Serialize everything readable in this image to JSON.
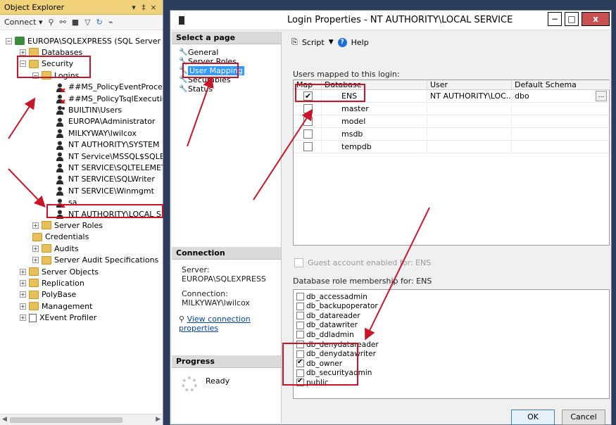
{
  "object_explorer": {
    "title": "Object Explorer",
    "title_controls": [
      "▾",
      "‡",
      "×"
    ],
    "toolbar": {
      "connect_label": "Connect ▾"
    },
    "tree": [
      {
        "label": "EUROPA\\SQLEXPRESS (SQL Server 13.0",
        "icon": "server-icon",
        "expander": "−",
        "level": 0
      },
      {
        "label": "Databases",
        "icon": "folder-icon",
        "expander": "+",
        "level": 1
      },
      {
        "label": "Security",
        "icon": "folder-icon",
        "expander": "−",
        "level": 1
      },
      {
        "label": "Logins",
        "icon": "folder-icon",
        "expander": "−",
        "level": 2
      },
      {
        "label": "##MS_PolicyEventProcessin",
        "icon": "login-disabled-icon",
        "level": 3
      },
      {
        "label": "##MS_PolicyTsqlExecutionL",
        "icon": "login-disabled-icon",
        "level": 3
      },
      {
        "label": "BUILTIN\\Users",
        "icon": "group-icon",
        "level": 3
      },
      {
        "label": "EUROPA\\Administrator",
        "icon": "user-icon",
        "level": 3
      },
      {
        "label": "MILKYWAY\\lwilcox",
        "icon": "user-icon",
        "level": 3
      },
      {
        "label": "NT AUTHORITY\\SYSTEM",
        "icon": "user-icon",
        "level": 3
      },
      {
        "label": "NT Service\\MSSQL$SQLEXP",
        "icon": "user-icon",
        "level": 3
      },
      {
        "label": "NT SERVICE\\SQLTELEMETRY",
        "icon": "user-icon",
        "level": 3
      },
      {
        "label": "NT SERVICE\\SQLWriter",
        "icon": "user-icon",
        "level": 3
      },
      {
        "label": "NT SERVICE\\Winmgmt",
        "icon": "user-icon",
        "level": 3
      },
      {
        "label": "sa",
        "icon": "login-disabled-icon",
        "level": 3
      },
      {
        "label": "NT AUTHORITY\\LOCAL SER",
        "icon": "user-icon",
        "level": 3
      },
      {
        "label": "Server Roles",
        "icon": "folder-icon",
        "expander": "+",
        "level": 2
      },
      {
        "label": "Credentials",
        "icon": "folder-icon",
        "level": 2
      },
      {
        "label": "Audits",
        "icon": "folder-icon",
        "expander": "+",
        "level": 2
      },
      {
        "label": "Server Audit Specifications",
        "icon": "folder-icon",
        "expander": "+",
        "level": 2
      },
      {
        "label": "Server Objects",
        "icon": "folder-icon",
        "expander": "+",
        "level": 1
      },
      {
        "label": "Replication",
        "icon": "folder-icon",
        "expander": "+",
        "level": 1
      },
      {
        "label": "PolyBase",
        "icon": "folder-icon",
        "expander": "+",
        "level": 1
      },
      {
        "label": "Management",
        "icon": "folder-icon",
        "expander": "+",
        "level": 1
      },
      {
        "label": "XEvent Profiler",
        "icon": "xevent-icon",
        "expander": "+",
        "level": 1
      }
    ]
  },
  "dialog": {
    "title": "Login Properties - NT AUTHORITY\\LOCAL SERVICE",
    "window_controls": {
      "minimize": "−",
      "maximize": "□",
      "close": "x"
    },
    "select_page": {
      "header": "Select a page",
      "pages": [
        "General",
        "Server Roles",
        "User Mapping",
        "Securables",
        "Status"
      ],
      "active": "User Mapping"
    },
    "connection": {
      "header": "Connection",
      "server_label": "Server:",
      "server_value": "EUROPA\\SQLEXPRESS",
      "connection_label": "Connection:",
      "connection_value": "MILKYWAY\\lwilcox",
      "view_link": "View connection properties"
    },
    "progress": {
      "header": "Progress",
      "status": "Ready"
    },
    "toolbar": {
      "script": "Script",
      "help": "Help"
    },
    "users_mapped_label": "Users mapped to this login:",
    "grid": {
      "columns": [
        "Map",
        "Database",
        "User",
        "Default Schema"
      ],
      "rows": [
        {
          "map": true,
          "database": "ENS",
          "user": "NT AUTHORITY\\LOC...",
          "schema": "dbo",
          "ellipsis": "..."
        },
        {
          "map": false,
          "database": "master",
          "user": "",
          "schema": ""
        },
        {
          "map": false,
          "database": "model",
          "user": "",
          "schema": ""
        },
        {
          "map": false,
          "database": "msdb",
          "user": "",
          "schema": ""
        },
        {
          "map": false,
          "database": "tempdb",
          "user": "",
          "schema": ""
        }
      ]
    },
    "guest_label": "Guest account enabled for: ENS",
    "role_membership_label": "Database role membership for: ENS",
    "roles": [
      {
        "name": "db_accessadmin",
        "checked": false
      },
      {
        "name": "db_backupoperator",
        "checked": false
      },
      {
        "name": "db_datareader",
        "checked": false
      },
      {
        "name": "db_datawriter",
        "checked": false
      },
      {
        "name": "db_ddladmin",
        "checked": false
      },
      {
        "name": "db_denydatareader",
        "checked": false
      },
      {
        "name": "db_denydatawriter",
        "checked": false
      },
      {
        "name": "db_owner",
        "checked": true
      },
      {
        "name": "db_securityadmin",
        "checked": false
      },
      {
        "name": "public",
        "checked": true
      }
    ],
    "buttons": {
      "ok": "OK",
      "cancel": "Cancel"
    }
  },
  "annotation_color": "#c9152a"
}
